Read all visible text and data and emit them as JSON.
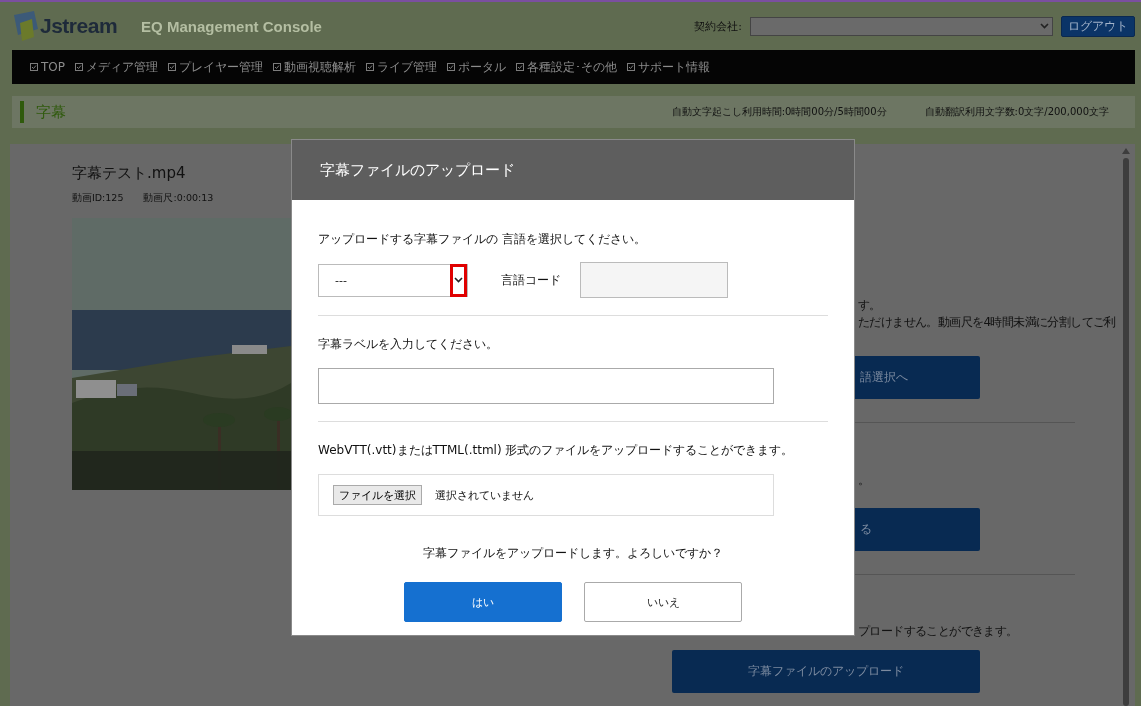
{
  "header": {
    "logo": "Jstream",
    "console_title": "EQ Management Console",
    "company_label": "契約会社:",
    "logout_button": "ログアウト"
  },
  "nav": [
    {
      "label": "TOP"
    },
    {
      "label": "メディア管理"
    },
    {
      "label": "プレイヤー管理"
    },
    {
      "label": "動画視聴解析"
    },
    {
      "label": "ライブ管理"
    },
    {
      "label": "ポータル"
    },
    {
      "label": "各種設定･その他"
    },
    {
      "label": "サポート情報"
    }
  ],
  "page_title": "字幕",
  "usage": [
    "自動文字起こし利用時間:0時間00分/5時間00分",
    "自動翻訳利用文字数:0文字/200,000文字"
  ],
  "video": {
    "title": "字幕テスト.mp4",
    "id": "動画ID:125",
    "duration": "動画尺:0:00:13",
    "kind": "picture"
  },
  "sections": [
    {
      "kind": "covered",
      "lines": [
        "す。",
        "ただけません。動画尺を4時間未満に分割してご利"
      ],
      "button": "語選択へ"
    },
    {
      "kind": "covered",
      "lines": [
        "。"
      ],
      "button": "る"
    },
    {
      "kind": "full",
      "lines": [
        "プロードすることができます。"
      ],
      "button": "字幕ファイルのアップロード"
    }
  ],
  "dialog": {
    "title": "字幕ファイルのアップロード",
    "language_prompt": "アップロードする字幕ファイルの 言語を選択してください。",
    "language_select": {
      "value": "---",
      "highlighted": true
    },
    "language_code_label": "言語コード",
    "label_prompt": "字幕ラベルを入力してください。",
    "file_prompt": "WebVTT(.vtt)またはTTML(.ttml) 形式のファイルをアップロードすることができます。",
    "file_button": "ファイルを選択",
    "file_status": "選択されていません",
    "confirm": "字幕ファイルをアップロードします。よろしいですか？",
    "yes_button": "はい",
    "no_button": "いいえ"
  }
}
